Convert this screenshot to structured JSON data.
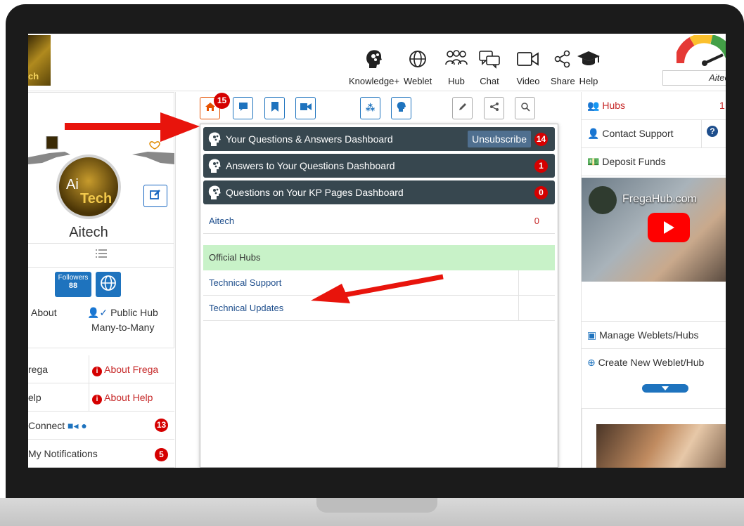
{
  "logo": {
    "text": "ch"
  },
  "topnav": [
    {
      "label": "Knowledge+",
      "icon": "brain-gear-icon"
    },
    {
      "label": "Weblet",
      "icon": "globe-icon"
    },
    {
      "label": "Hub",
      "icon": "people-icon"
    },
    {
      "label": "Chat",
      "icon": "chat-bubbles-icon"
    },
    {
      "label": "Video",
      "icon": "video-camera-icon"
    },
    {
      "label": "Share",
      "icon": "share-icon"
    },
    {
      "label": "Help",
      "icon": "graduation-cap-icon"
    }
  ],
  "user": {
    "short_name": "Aitec"
  },
  "profile": {
    "name": "Aitech",
    "avatar_text_1": "Ai",
    "avatar_text_2": "Tech",
    "followers_label": "Followers",
    "followers_count": "88",
    "about_label": "About",
    "hub_type_label": "Public Hub",
    "hub_type_sub": "Many-to-Many"
  },
  "left_menu": [
    {
      "left": "rega",
      "right": "About Frega"
    },
    {
      "left": "elp",
      "right": "About Help"
    },
    {
      "left": "Connect",
      "badge": "13"
    },
    {
      "left": "My Notifications",
      "badge": "5"
    }
  ],
  "toolbar": {
    "home_badge": "15"
  },
  "dashboards": [
    {
      "title": "Your Questions & Answers Dashboard",
      "count": "14",
      "action": "Unsubscribe"
    },
    {
      "title": "Answers to Your Questions Dashboard",
      "count": "1"
    },
    {
      "title": "Questions on Your KP Pages Dashboard",
      "count": "0"
    }
  ],
  "pages": [
    {
      "name": "Aitech",
      "count": "0"
    }
  ],
  "official_hubs": {
    "header": "Official Hubs",
    "items": [
      "Technical Support",
      "Technical Updates"
    ]
  },
  "right_menu": {
    "hubs_label": "Hubs",
    "hubs_count": "1",
    "contact_support": "Contact Support",
    "deposit_funds": "Deposit Funds",
    "video_title": "FregaHub.com",
    "manage": "Manage Weblets/Hubs",
    "create": "Create New Weblet/Hub"
  },
  "colors": {
    "accent_blue": "#1e73be",
    "dashboard_bar": "#37474f",
    "badge_red": "#d50000",
    "official_green": "#c8f2c8",
    "annotation_arrow": "#e8140c"
  }
}
